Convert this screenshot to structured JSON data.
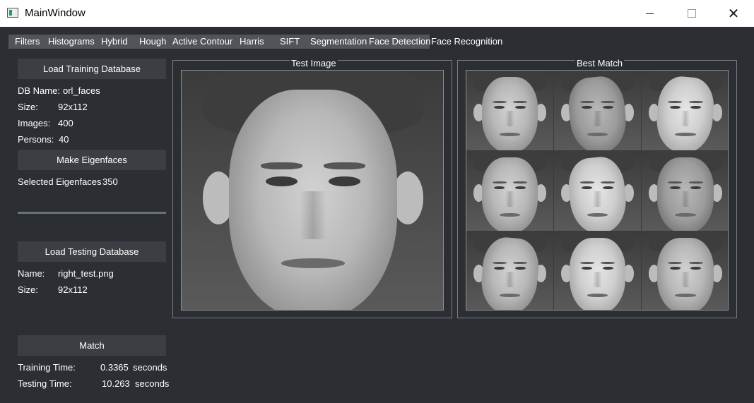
{
  "window": {
    "title": "MainWindow",
    "minimize_glyph": "",
    "close_glyph": "✕"
  },
  "tabs": [
    "Filters",
    "Histograms",
    "Hybrid",
    "Hough",
    "Active Contour",
    "Harris",
    "SIFT",
    "Segmentation",
    "Face Detection",
    "Face Recognition"
  ],
  "active_tab": "Face Recognition",
  "training": {
    "load_button": "Load Training Database",
    "db_name_label": "DB Name:",
    "db_name_value": "orl_faces",
    "size_label": "Size:",
    "size_value": "92x112",
    "images_label": "Images:",
    "images_value": "400",
    "persons_label": "Persons:",
    "persons_value": "40"
  },
  "eigen": {
    "button": "Make Eigenfaces",
    "selected_label": "Selected Eigenfaces",
    "selected_value": "350"
  },
  "testing": {
    "load_button": "Load Testing Database",
    "name_label": "Name:",
    "name_value": "right_test.png",
    "size_label": "Size:",
    "size_value": "92x112"
  },
  "match": {
    "button": "Match",
    "training_time_label": "Training Time:",
    "training_time_value": "0.3365",
    "training_time_unit": "seconds",
    "testing_time_label": "Testing Time:",
    "testing_time_value": "10.263",
    "testing_time_unit": "seconds"
  },
  "panels": {
    "test_image_title": "Test Image",
    "best_match_title": "Best Match"
  },
  "colors": {
    "background": "#2b2f33",
    "button": "#3b3f43",
    "tab_strip": "#515559",
    "text": "#ffffff"
  }
}
